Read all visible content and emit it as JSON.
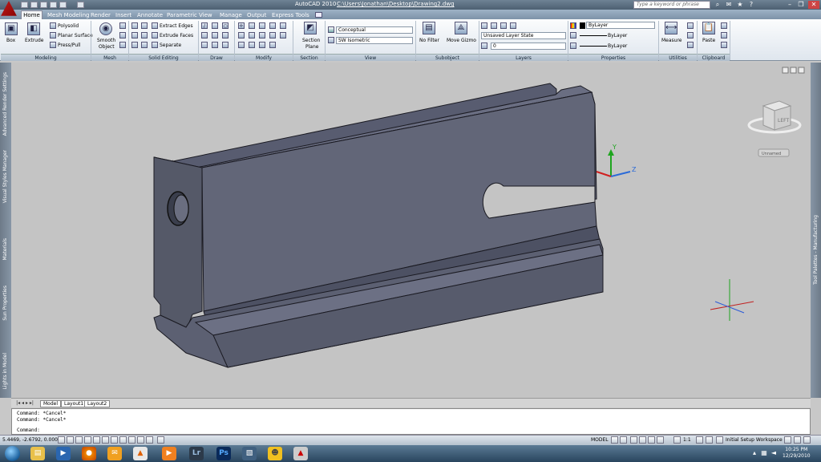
{
  "titlebar": {
    "title": "AutoCAD 2010",
    "file_path": "C:\\Users\\Jonathan\\Desktop\\Drawing2.dwg",
    "search_placeholder": "Type a keyword or phrase"
  },
  "tabs": [
    "Home",
    "Mesh Modeling",
    "Render",
    "Insert",
    "Annotate",
    "Parametric",
    "View",
    "Manage",
    "Output",
    "Express Tools"
  ],
  "ribbon": {
    "modeling": {
      "title": "Modeling",
      "box": "Box",
      "extrude": "Extrude",
      "polysolid": "Polysolid",
      "planar_surface": "Planar Surface",
      "press_pull": "Press/Pull"
    },
    "mesh": {
      "title": "Mesh",
      "smooth_object_line1": "Smooth",
      "smooth_object_line2": "Object"
    },
    "solid_editing": {
      "title": "Solid Editing",
      "extract_edges": "Extract Edges",
      "extrude_faces": "Extrude Faces",
      "separate": "Separate"
    },
    "draw": {
      "title": "Draw"
    },
    "modify": {
      "title": "Modify"
    },
    "section": {
      "title": "Section",
      "section_plane_line1": "Section",
      "section_plane_line2": "Plane"
    },
    "view": {
      "title": "View",
      "visual_style": "Conceptual",
      "view_direction": "SW Isometric"
    },
    "subobject": {
      "title": "Subobject",
      "no_filter": "No Filter",
      "move_gizmo": "Move Gizmo"
    },
    "layers": {
      "title": "Layers",
      "layer_state": "Unsaved Layer State",
      "current_layer": "0"
    },
    "properties": {
      "title": "Properties",
      "color": "ByLayer",
      "linetype": "ByLayer",
      "lineweight": "ByLayer"
    },
    "utilities": {
      "title": "Utilities",
      "measure": "Measure"
    },
    "clipboard": {
      "title": "Clipboard",
      "paste": "Paste"
    }
  },
  "side_palettes": {
    "left": [
      "Advanced Render Settings",
      "Visual Styles Manager",
      "Materials",
      "Sun Properties",
      "Lights in Model"
    ],
    "right": "Tool Palettes - Manufacturing"
  },
  "viewcube": {
    "face_label": "LEFT",
    "unnamed_label": "Unnamed"
  },
  "layout_tabs": [
    "Model",
    "Layout1",
    "Layout2"
  ],
  "command_history": [
    "Command: *Cancel*",
    "Command: *Cancel*"
  ],
  "command_prompt": "Command:",
  "status": {
    "coordinates": "5.4469, -2.6792, 0.0000",
    "model_label": "MODEL",
    "scale": "1:1",
    "workspace": "Initial Setup Workspace"
  },
  "taskbar": {
    "apps": [
      "Windows Explorer",
      "Media Player",
      "Firefox",
      "Outlook",
      "VLC",
      "Lightroom",
      "Photoshop",
      "Image Viewer",
      "Messenger",
      "AutoCAD"
    ],
    "lr_label": "Lr",
    "ps_label": "Ps",
    "time": "10:25 PM",
    "date": "12/29/2010"
  }
}
